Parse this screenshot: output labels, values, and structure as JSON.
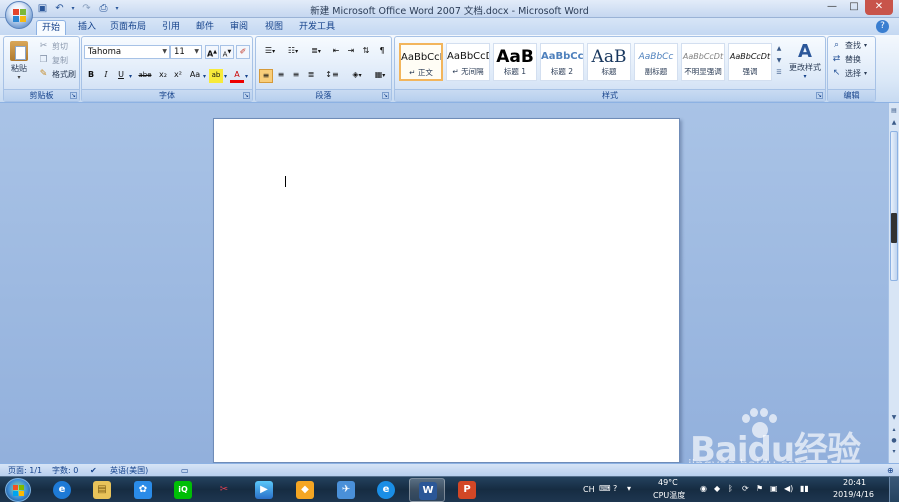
{
  "window": {
    "title": "新建 Microsoft Office Word 2007 文档.docx - Microsoft Word",
    "controls": [
      "—",
      "□",
      "✕"
    ]
  },
  "tabs": [
    "开始",
    "插入",
    "页面布局",
    "引用",
    "邮件",
    "审阅",
    "视图",
    "开发工具"
  ],
  "ribbon": {
    "clipboard": {
      "label": "剪贴板",
      "paste": "粘贴",
      "cut": "剪切",
      "copy": "复制",
      "format_painter": "格式刷"
    },
    "font": {
      "label": "字体",
      "font_name": "Tahoma",
      "font_size": "11",
      "grow": "A",
      "shrink": "A",
      "buttons": [
        "B",
        "I",
        "U",
        "abe",
        "x₂",
        "x²",
        "Aa",
        "ab",
        "A"
      ]
    },
    "paragraph": {
      "label": "段落"
    },
    "styles": {
      "label": "样式",
      "items": [
        {
          "sample": "AaBbCcD",
          "name": "↵ 正文"
        },
        {
          "sample": "AaBbCcD",
          "name": "↵ 无间隔"
        },
        {
          "sample": "AaB",
          "name": "标题 1"
        },
        {
          "sample": "AaBbCc",
          "name": "标题 2"
        },
        {
          "sample": "AaB",
          "name": "标题"
        },
        {
          "sample": "AaBbCc",
          "name": "副标题"
        },
        {
          "sample": "AaBbCcDt",
          "name": "不明显强调"
        },
        {
          "sample": "AaBbCcDt",
          "name": "强调"
        }
      ],
      "change_styles": "更改样式"
    },
    "editing": {
      "label": "编辑",
      "find": "查找",
      "replace": "替换",
      "select": "选择"
    }
  },
  "statusbar": {
    "page": "页面: 1/1",
    "words": "字数: 0",
    "language": "英语(美国)"
  },
  "taskbar": {
    "ime": "CH",
    "temperature": "49°C",
    "temperature_label": "CPU温度",
    "time": "20:41",
    "date": "2019/4/16"
  },
  "watermark": {
    "brand": "Baidu经验",
    "url": "jingyan.baidu.com"
  }
}
